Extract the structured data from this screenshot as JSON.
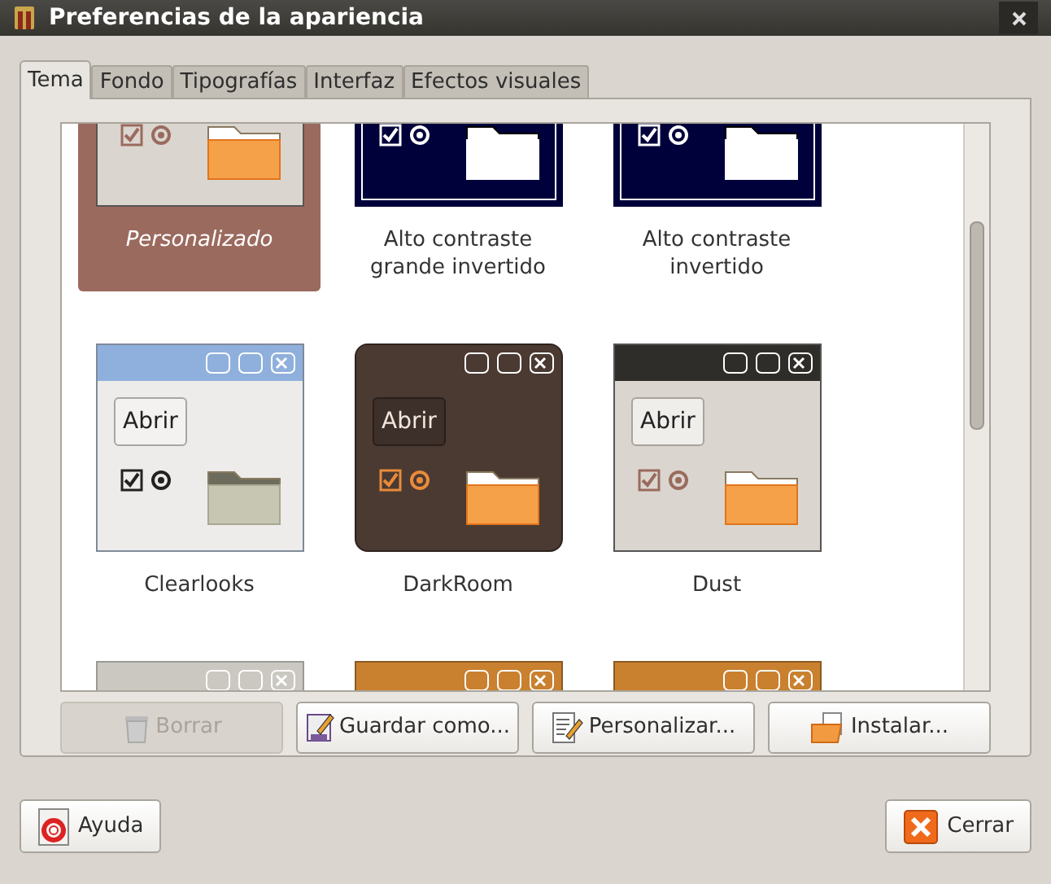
{
  "window": {
    "title": "Preferencias de la apariencia"
  },
  "tabs": [
    {
      "label": "Tema",
      "selected": true
    },
    {
      "label": "Fondo",
      "selected": false
    },
    {
      "label": "Tipografías",
      "selected": false
    },
    {
      "label": "Interfaz",
      "selected": false
    },
    {
      "label": "Efectos visuales",
      "selected": false
    }
  ],
  "themes": [
    {
      "kind": "custom",
      "label": "Personalizado",
      "selected": true
    },
    {
      "kind": "contrast",
      "label": "Alto contraste grande invertido",
      "selected": false
    },
    {
      "kind": "contrast",
      "label": "Alto contraste invertido",
      "selected": false
    },
    {
      "kind": "clearlooks",
      "label": "Clearlooks",
      "button": "Abrir",
      "selected": false
    },
    {
      "kind": "darkroom",
      "label": "DarkRoom",
      "button": "Abrir",
      "selected": false
    },
    {
      "kind": "dust",
      "label": "Dust",
      "button": "Abrir",
      "selected": false
    },
    {
      "kind": "gray",
      "selected": false
    },
    {
      "kind": "orange",
      "selected": false
    },
    {
      "kind": "orange",
      "selected": false
    }
  ],
  "theme_buttons": [
    {
      "kind": "delete",
      "label": "Borrar",
      "disabled": true
    },
    {
      "kind": "save",
      "label": "Guardar como...",
      "disabled": false
    },
    {
      "kind": "edit",
      "label": "Personalizar...",
      "disabled": false
    },
    {
      "kind": "install",
      "label": "Instalar...",
      "disabled": false
    }
  ],
  "footer_buttons": [
    {
      "kind": "help",
      "label": "Ayuda"
    },
    {
      "kind": "close",
      "label": "Cerrar"
    }
  ]
}
